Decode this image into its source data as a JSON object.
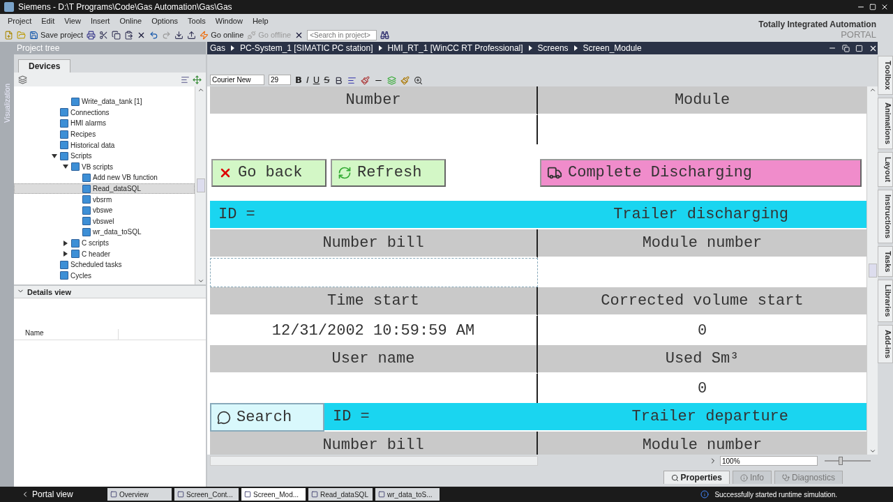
{
  "window": {
    "title": "Siemens - D:\\T Programs\\Code\\Gas Automation\\Gas\\Gas"
  },
  "menu": [
    "Project",
    "Edit",
    "View",
    "Insert",
    "Online",
    "Options",
    "Tools",
    "Window",
    "Help"
  ],
  "branding": {
    "line1": "Totally Integrated Automation",
    "line2": "PORTAL"
  },
  "toolbar": {
    "save": "Save project",
    "go_online": "Go online",
    "go_offline": {
      "label": "Go offline",
      "disabled": true
    },
    "search": {
      "placeholder": "<Search in project>"
    }
  },
  "side_tab": "Visualization",
  "project_tree": {
    "title": "Project tree",
    "tabs": [
      {
        "label": "Devices",
        "selected": true
      }
    ],
    "orphans": [
      {
        "label": "Write_data_tank [1]",
        "selected": false
      }
    ],
    "items": [
      {
        "label": "Connections",
        "selected": false
      },
      {
        "label": "HMI alarms",
        "selected": false
      },
      {
        "label": "Recipes",
        "selected": false
      },
      {
        "label": "Historical data",
        "selected": false
      },
      {
        "label": "Scripts",
        "selected": false,
        "expanded": true,
        "children": [
          {
            "label": "VB scripts",
            "selected": false,
            "expanded": true,
            "children": [
              {
                "label": "Add new VB function",
                "selected": false
              },
              {
                "label": "Read_dataSQL",
                "selected": true
              },
              {
                "label": "vbsrm",
                "selected": false
              },
              {
                "label": "vbswe",
                "selected": false
              },
              {
                "label": "vbswel",
                "selected": false
              },
              {
                "label": "wr_data_toSQL",
                "selected": false
              }
            ]
          },
          {
            "label": "C scripts",
            "selected": false,
            "expanded": false
          },
          {
            "label": "C header",
            "selected": false,
            "expanded": false
          }
        ]
      },
      {
        "label": "Scheduled tasks",
        "selected": false
      },
      {
        "label": "Cycles",
        "selected": false
      }
    ]
  },
  "details_view": {
    "title": "Details view",
    "expanded": true,
    "columns": [
      "Name"
    ]
  },
  "breadcrumb": [
    "Gas",
    "PC-System_1 [SIMATIC PC station]",
    "HMI_RT_1 [WinCC RT Professional]",
    "Screens",
    "Screen_Module"
  ],
  "format_toolbar": {
    "font": "Courier New",
    "size": "29",
    "style_buttons": [
      "B",
      "I",
      "U",
      "S"
    ]
  },
  "screen": {
    "rows": [
      {
        "kind": "header",
        "cells": [
          "Number",
          "Module"
        ]
      },
      {
        "kind": "values",
        "cells": [
          {
            "selected": false
          },
          {
            "selected": false
          }
        ]
      },
      {
        "kind": "buttons",
        "buttons": [
          {
            "label": "Go back",
            "color": "#d3f7c6"
          },
          {
            "label": "Refresh",
            "color": "#d3f7c6"
          },
          {
            "label": "Complete Discharging",
            "color": "#f08ccb"
          }
        ]
      },
      {
        "kind": "banner",
        "left": "ID =",
        "right": "Trailer discharging"
      },
      {
        "kind": "header",
        "cells": [
          "Number bill",
          "Module number"
        ]
      },
      {
        "kind": "values",
        "cells": [
          {
            "selected": true
          },
          {
            "selected": false
          }
        ]
      },
      {
        "kind": "header",
        "cells": [
          "Time start",
          "Corrected volume start"
        ]
      },
      {
        "kind": "values",
        "cells": [
          {
            "value": "12/31/2002 10:59:59 AM",
            "selected": false
          },
          {
            "value": "0",
            "selected": false
          }
        ]
      },
      {
        "kind": "header",
        "cells": [
          "User name",
          "Used Sm³"
        ]
      },
      {
        "kind": "values",
        "cells": [
          {
            "selected": false
          },
          {
            "value": "0",
            "selected": false
          }
        ]
      },
      {
        "kind": "search_banner",
        "button": "Search",
        "left": "ID =",
        "right": "Trailer departure"
      },
      {
        "kind": "header",
        "cells": [
          "Number bill",
          "Module number"
        ]
      }
    ]
  },
  "zoom": {
    "value": "100%",
    "level": 0.35
  },
  "right_tabs": [
    "Toolbox",
    "Animations",
    "Layout",
    "Instructions",
    "Tasks",
    "Libraries",
    "Add-ins"
  ],
  "bottom_tabs": [
    {
      "label": "Properties",
      "selected": true
    },
    {
      "label": "Info",
      "selected": false
    },
    {
      "label": "Diagnostics",
      "selected": false
    }
  ],
  "taskbar": {
    "portal": "Portal view",
    "tabs": [
      {
        "label": "Overview",
        "selected": false
      },
      {
        "label": "Screen_Cont...",
        "selected": false
      },
      {
        "label": "Screen_Mod...",
        "selected": true
      },
      {
        "label": "Read_dataSQL",
        "selected": false
      },
      {
        "label": "wr_data_toS...",
        "selected": false
      }
    ],
    "status": "Successfully started runtime simulation."
  }
}
